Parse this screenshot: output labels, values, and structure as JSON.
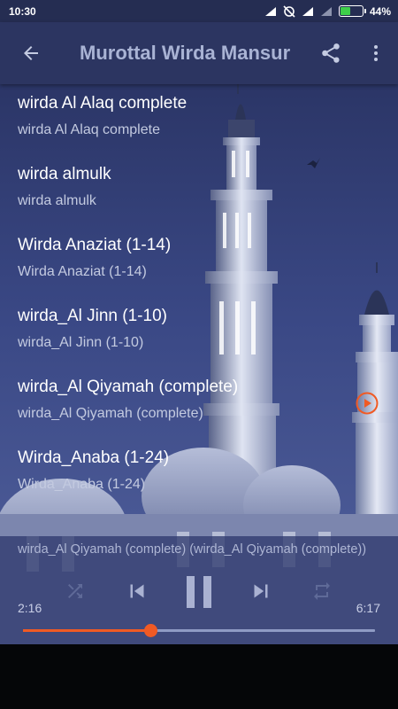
{
  "status_bar": {
    "time": "10:30",
    "battery_percent_text": "44%",
    "battery_level": 0.44
  },
  "toolbar": {
    "title": "Murottal Wirda Mansur"
  },
  "tracks": [
    {
      "title": "wirda Al Alaq complete",
      "subtitle": "wirda Al Alaq complete"
    },
    {
      "title": "wirda almulk",
      "subtitle": "wirda almulk"
    },
    {
      "title": "Wirda Anaziat (1-14)",
      "subtitle": "Wirda Anaziat (1-14)"
    },
    {
      "title": "wirda_Al Jinn (1-10)",
      "subtitle": "wirda_Al Jinn (1-10)"
    },
    {
      "title": "wirda_Al Qiyamah (complete)",
      "subtitle": "wirda_Al Qiyamah (complete)",
      "playing": true
    },
    {
      "title": "Wirda_Anaba (1-24)",
      "subtitle": "Wirda_Anaba (1-24)"
    }
  ],
  "player": {
    "now_playing": "wirda_Al Qiyamah (complete) (wirda_Al Qiyamah (complete))",
    "elapsed": "2:16",
    "duration": "6:17",
    "progress": 0.362
  },
  "colors": {
    "accent": "#f05a24",
    "toolbar": "#2c3561",
    "status_bar": "#252d52"
  },
  "icons": [
    "back-arrow-icon",
    "share-icon",
    "more-vert-icon",
    "shuffle-icon",
    "skip-previous-icon",
    "pause-icon",
    "skip-next-icon",
    "repeat-icon",
    "play-circle-icon"
  ]
}
